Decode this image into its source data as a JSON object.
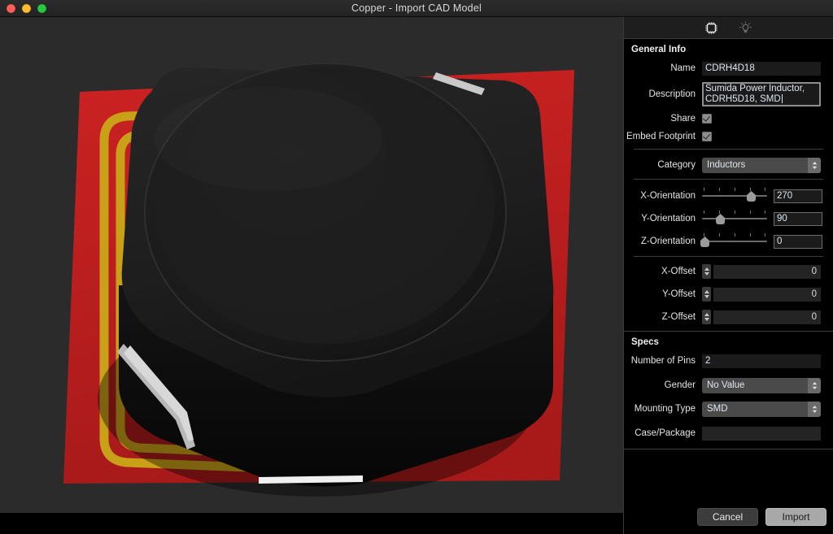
{
  "window": {
    "title": "Copper - Import CAD Model",
    "controls": {
      "close": "close-button",
      "minimize": "minimize-button",
      "zoom": "zoom-button"
    }
  },
  "toolbar": {
    "tabs": [
      {
        "name": "chip-tab",
        "icon": "chip-icon",
        "selected": true
      },
      {
        "name": "lightbulb-tab",
        "icon": "lightbulb-icon",
        "selected": false
      }
    ]
  },
  "general_info": {
    "heading": "General Info",
    "name": {
      "label": "Name",
      "value": "CDRH4D18"
    },
    "description": {
      "label": "Description",
      "value": "Sumida Power Inductor, CDRH5D18, SMD"
    },
    "share": {
      "label": "Share",
      "checked": true
    },
    "embed_footprint": {
      "label": "Embed Footprint",
      "checked": true
    },
    "category": {
      "label": "Category",
      "value": "Inductors"
    },
    "orientation": [
      {
        "label": "X-Orientation",
        "value": "270",
        "percent": 75
      },
      {
        "label": "Y-Orientation",
        "value": "90",
        "percent": 25
      },
      {
        "label": "Z-Orientation",
        "value": "0",
        "percent": 0
      }
    ],
    "offsets": [
      {
        "label": "X-Offset",
        "value": "0"
      },
      {
        "label": "Y-Offset",
        "value": "0"
      },
      {
        "label": "Z-Offset",
        "value": "0"
      }
    ]
  },
  "specs": {
    "heading": "Specs",
    "number_of_pins": {
      "label": "Number of Pins",
      "value": "2"
    },
    "gender": {
      "label": "Gender",
      "value": "No Value"
    },
    "mounting_type": {
      "label": "Mounting Type",
      "value": "SMD"
    },
    "case_package": {
      "label": "Case/Package",
      "value": ""
    }
  },
  "footer": {
    "cancel": "Cancel",
    "import": "Import"
  },
  "viewport": {
    "scene": "3d-cad-model-inductor-on-pcb",
    "colors": {
      "background": "#2b2b2b",
      "pcb_red": "#c02020",
      "trace_gold": "#c9a119",
      "body_black": "#1a1a1a",
      "pad_silver": "#d8d8d8"
    }
  }
}
